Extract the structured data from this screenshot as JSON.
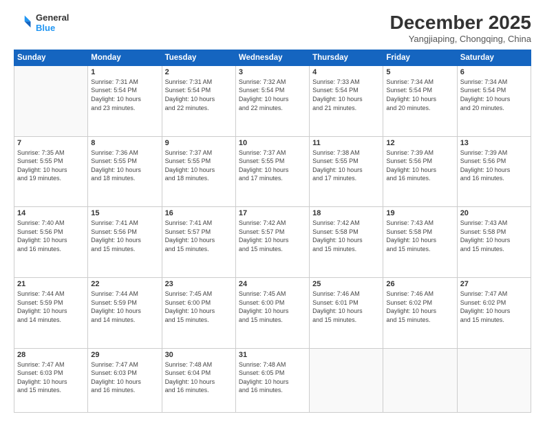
{
  "header": {
    "logo_line1": "General",
    "logo_line2": "Blue",
    "month_title": "December 2025",
    "subtitle": "Yangjiaping, Chongqing, China"
  },
  "days_of_week": [
    "Sunday",
    "Monday",
    "Tuesday",
    "Wednesday",
    "Thursday",
    "Friday",
    "Saturday"
  ],
  "weeks": [
    [
      {
        "day": "",
        "info": ""
      },
      {
        "day": "1",
        "info": "Sunrise: 7:31 AM\nSunset: 5:54 PM\nDaylight: 10 hours\nand 23 minutes."
      },
      {
        "day": "2",
        "info": "Sunrise: 7:31 AM\nSunset: 5:54 PM\nDaylight: 10 hours\nand 22 minutes."
      },
      {
        "day": "3",
        "info": "Sunrise: 7:32 AM\nSunset: 5:54 PM\nDaylight: 10 hours\nand 22 minutes."
      },
      {
        "day": "4",
        "info": "Sunrise: 7:33 AM\nSunset: 5:54 PM\nDaylight: 10 hours\nand 21 minutes."
      },
      {
        "day": "5",
        "info": "Sunrise: 7:34 AM\nSunset: 5:54 PM\nDaylight: 10 hours\nand 20 minutes."
      },
      {
        "day": "6",
        "info": "Sunrise: 7:34 AM\nSunset: 5:54 PM\nDaylight: 10 hours\nand 20 minutes."
      }
    ],
    [
      {
        "day": "7",
        "info": "Sunrise: 7:35 AM\nSunset: 5:55 PM\nDaylight: 10 hours\nand 19 minutes."
      },
      {
        "day": "8",
        "info": "Sunrise: 7:36 AM\nSunset: 5:55 PM\nDaylight: 10 hours\nand 18 minutes."
      },
      {
        "day": "9",
        "info": "Sunrise: 7:37 AM\nSunset: 5:55 PM\nDaylight: 10 hours\nand 18 minutes."
      },
      {
        "day": "10",
        "info": "Sunrise: 7:37 AM\nSunset: 5:55 PM\nDaylight: 10 hours\nand 17 minutes."
      },
      {
        "day": "11",
        "info": "Sunrise: 7:38 AM\nSunset: 5:55 PM\nDaylight: 10 hours\nand 17 minutes."
      },
      {
        "day": "12",
        "info": "Sunrise: 7:39 AM\nSunset: 5:56 PM\nDaylight: 10 hours\nand 16 minutes."
      },
      {
        "day": "13",
        "info": "Sunrise: 7:39 AM\nSunset: 5:56 PM\nDaylight: 10 hours\nand 16 minutes."
      }
    ],
    [
      {
        "day": "14",
        "info": "Sunrise: 7:40 AM\nSunset: 5:56 PM\nDaylight: 10 hours\nand 16 minutes."
      },
      {
        "day": "15",
        "info": "Sunrise: 7:41 AM\nSunset: 5:56 PM\nDaylight: 10 hours\nand 15 minutes."
      },
      {
        "day": "16",
        "info": "Sunrise: 7:41 AM\nSunset: 5:57 PM\nDaylight: 10 hours\nand 15 minutes."
      },
      {
        "day": "17",
        "info": "Sunrise: 7:42 AM\nSunset: 5:57 PM\nDaylight: 10 hours\nand 15 minutes."
      },
      {
        "day": "18",
        "info": "Sunrise: 7:42 AM\nSunset: 5:58 PM\nDaylight: 10 hours\nand 15 minutes."
      },
      {
        "day": "19",
        "info": "Sunrise: 7:43 AM\nSunset: 5:58 PM\nDaylight: 10 hours\nand 15 minutes."
      },
      {
        "day": "20",
        "info": "Sunrise: 7:43 AM\nSunset: 5:58 PM\nDaylight: 10 hours\nand 15 minutes."
      }
    ],
    [
      {
        "day": "21",
        "info": "Sunrise: 7:44 AM\nSunset: 5:59 PM\nDaylight: 10 hours\nand 14 minutes."
      },
      {
        "day": "22",
        "info": "Sunrise: 7:44 AM\nSunset: 5:59 PM\nDaylight: 10 hours\nand 14 minutes."
      },
      {
        "day": "23",
        "info": "Sunrise: 7:45 AM\nSunset: 6:00 PM\nDaylight: 10 hours\nand 15 minutes."
      },
      {
        "day": "24",
        "info": "Sunrise: 7:45 AM\nSunset: 6:00 PM\nDaylight: 10 hours\nand 15 minutes."
      },
      {
        "day": "25",
        "info": "Sunrise: 7:46 AM\nSunset: 6:01 PM\nDaylight: 10 hours\nand 15 minutes."
      },
      {
        "day": "26",
        "info": "Sunrise: 7:46 AM\nSunset: 6:02 PM\nDaylight: 10 hours\nand 15 minutes."
      },
      {
        "day": "27",
        "info": "Sunrise: 7:47 AM\nSunset: 6:02 PM\nDaylight: 10 hours\nand 15 minutes."
      }
    ],
    [
      {
        "day": "28",
        "info": "Sunrise: 7:47 AM\nSunset: 6:03 PM\nDaylight: 10 hours\nand 15 minutes."
      },
      {
        "day": "29",
        "info": "Sunrise: 7:47 AM\nSunset: 6:03 PM\nDaylight: 10 hours\nand 16 minutes."
      },
      {
        "day": "30",
        "info": "Sunrise: 7:48 AM\nSunset: 6:04 PM\nDaylight: 10 hours\nand 16 minutes."
      },
      {
        "day": "31",
        "info": "Sunrise: 7:48 AM\nSunset: 6:05 PM\nDaylight: 10 hours\nand 16 minutes."
      },
      {
        "day": "",
        "info": ""
      },
      {
        "day": "",
        "info": ""
      },
      {
        "day": "",
        "info": ""
      }
    ]
  ]
}
